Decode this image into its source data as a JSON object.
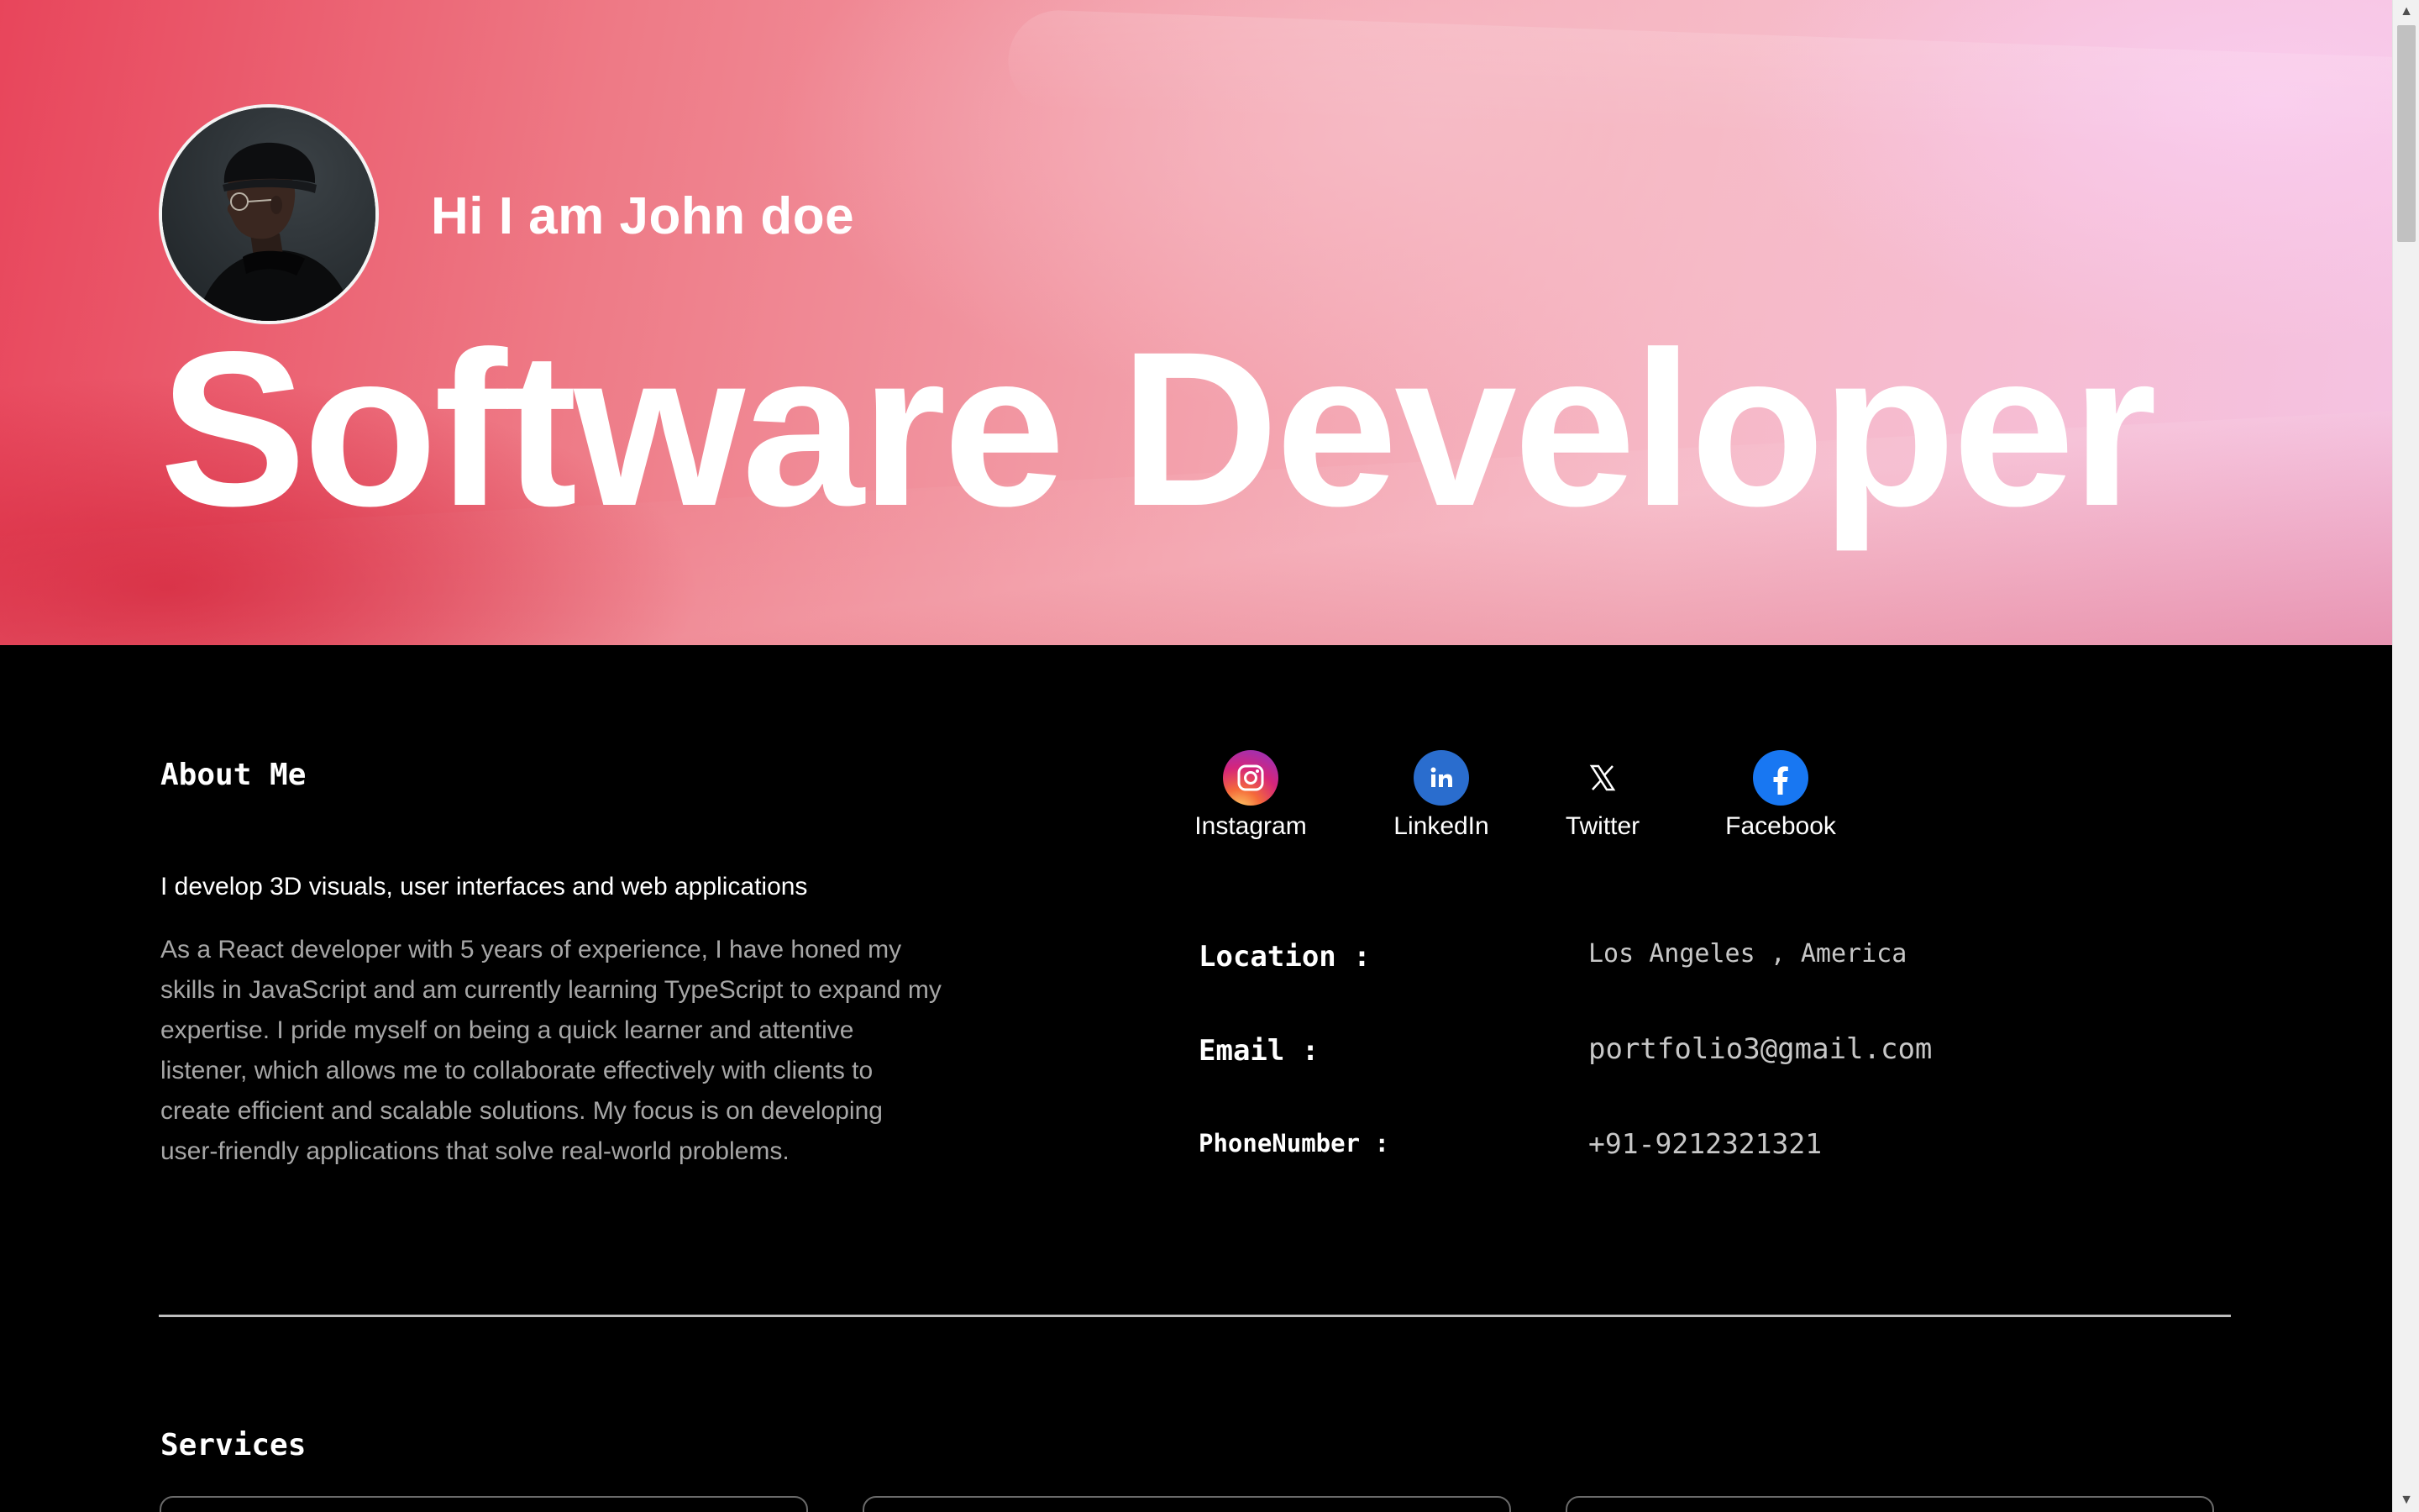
{
  "hero": {
    "greeting": "Hi I am John doe",
    "headline": "Software Developer"
  },
  "about": {
    "title": "About Me",
    "tagline": "I develop 3D visuals, user interfaces and web applications",
    "body": "As a React developer with 5 years of experience, I have honed my skills in JavaScript and am currently learning TypeScript to expand my expertise. I pride myself on being a quick learner and attentive listener, which allows me to collaborate effectively with clients to create efficient and scalable solutions. My focus is on developing user-friendly applications that solve real-world problems."
  },
  "socials": [
    {
      "label": "Instagram",
      "icon": "instagram-icon"
    },
    {
      "label": "LinkedIn",
      "icon": "linkedin-icon"
    },
    {
      "label": "Twitter",
      "icon": "x-twitter-icon"
    },
    {
      "label": "Facebook",
      "icon": "facebook-icon"
    }
  ],
  "contact": {
    "location_label": "Location :",
    "location_value": "Los Angeles , America",
    "email_label": "Email :",
    "email_value": "portfolio3@gmail.com",
    "phone_label": "PhoneNumber :",
    "phone_value": "+91-9212321321"
  },
  "services": {
    "title": "Services"
  },
  "colors": {
    "page_background": "#000000",
    "hero_pink": "#f3a0ab",
    "hero_red": "#e8455b",
    "muted_text": "#a6a6a6"
  }
}
